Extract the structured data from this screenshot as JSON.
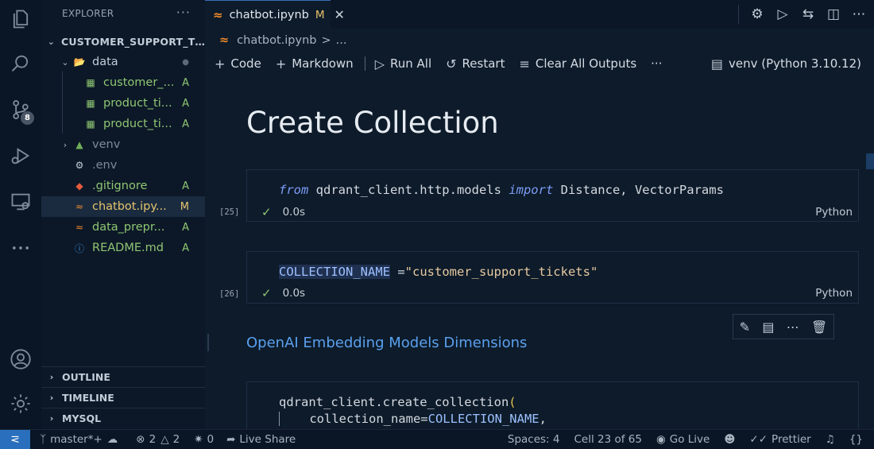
{
  "activity": {
    "source_control_badge": "8"
  },
  "sidebar": {
    "title": "EXPLORER",
    "more": "···",
    "root": "CUSTOMER_SUPPORT_TI...",
    "items": [
      {
        "label": "data",
        "status": ""
      },
      {
        "label": "customer_...",
        "status": "A"
      },
      {
        "label": "product_ti...",
        "status": "A"
      },
      {
        "label": "product_ti...",
        "status": "A"
      },
      {
        "label": "venv",
        "status": ""
      },
      {
        "label": ".env",
        "status": ""
      },
      {
        "label": ".gitignore",
        "status": "A"
      },
      {
        "label": "chatbot.ipy...",
        "status": "M"
      },
      {
        "label": "data_prepr...",
        "status": "A"
      },
      {
        "label": "README.md",
        "status": "A"
      }
    ],
    "sections": [
      "OUTLINE",
      "TIMELINE",
      "MYSQL"
    ]
  },
  "tab": {
    "name": "chatbot.ipynb",
    "modified": "M",
    "close": "✕"
  },
  "breadcrumb": {
    "file": "chatbot.ipynb",
    "sep": ">",
    "rest": "..."
  },
  "toolbar": {
    "code": "Code",
    "markdown": "Markdown",
    "run_all": "Run All",
    "restart": "Restart",
    "clear": "Clear All Outputs",
    "more": "···",
    "kernel": "venv (Python 3.10.12)"
  },
  "notebook": {
    "heading": "Create Collection",
    "cell1": {
      "exec": "[25]",
      "kw_from": "from",
      "module": " qdrant_client.http.models ",
      "kw_import": "import",
      "names": " Distance, VectorParams",
      "time": "0.0s",
      "lang": "Python"
    },
    "cell2": {
      "exec": "[26]",
      "var": "COLLECTION_NAME",
      "eq": " =",
      "str": "\"customer_support_tickets\"",
      "time": "0.0s",
      "lang": "Python"
    },
    "subheading": "OpenAI Embedding Models Dimensions",
    "cell3": {
      "line1": "qdrant_client.create_collection",
      "paren": "(",
      "line2_arg": "    collection_name=",
      "line2_var": "COLLECTION_NAME",
      "line2_end": ","
    }
  },
  "status": {
    "branch": "master*+",
    "errors": "2",
    "warnings": "2",
    "ports": "0",
    "live_share": "Live Share",
    "spaces": "Spaces: 4",
    "cell": "Cell 23 of 65",
    "go_live": "Go Live",
    "prettier": "Prettier"
  }
}
